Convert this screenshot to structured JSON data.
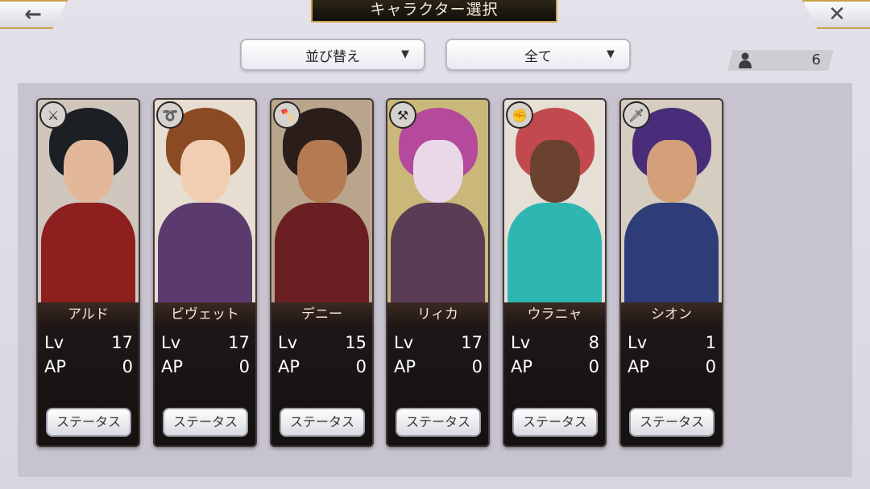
{
  "header": {
    "back_icon": "←",
    "title": "キャラクター選択",
    "close_icon": "✕"
  },
  "filters": {
    "sort_label": "並び替え",
    "filter_label": "全て",
    "arrow": "▼"
  },
  "count": {
    "value": "6"
  },
  "characters": [
    {
      "name": "アルド",
      "lv_label": "Lv",
      "lv": "17",
      "ap_label": "AP",
      "ap": "0",
      "status_label": "ステータス",
      "weapon_icon": "sword-icon",
      "weapon_glyph": "⚔",
      "colors": {
        "bg": "#cfc7bd",
        "hair": "#1c1f24",
        "face": "#e3b89a",
        "body": "#8e1f1f"
      }
    },
    {
      "name": "ビヴェット",
      "lv_label": "Lv",
      "lv": "17",
      "ap_label": "AP",
      "ap": "0",
      "status_label": "ステータス",
      "weapon_icon": "whip-icon",
      "weapon_glyph": "➰",
      "colors": {
        "bg": "#e7ddd0",
        "hair": "#8a4a23",
        "face": "#f1cdb2",
        "body": "#5b3b6e"
      }
    },
    {
      "name": "デニー",
      "lv_label": "Lv",
      "lv": "15",
      "ap_label": "AP",
      "ap": "0",
      "status_label": "ステータス",
      "weapon_icon": "axe-icon",
      "weapon_glyph": "🪓",
      "colors": {
        "bg": "#b9a58c",
        "hair": "#2a1d1a",
        "face": "#b47a52",
        "body": "#6b1f22"
      }
    },
    {
      "name": "リィカ",
      "lv_label": "Lv",
      "lv": "17",
      "ap_label": "AP",
      "ap": "0",
      "status_label": "ステータス",
      "weapon_icon": "hammer-icon",
      "weapon_glyph": "⚒",
      "colors": {
        "bg": "#c9b87a",
        "hair": "#b54a9c",
        "face": "#e9d8e8",
        "body": "#5a3d55"
      }
    },
    {
      "name": "ウラニャ",
      "lv_label": "Lv",
      "lv": "8",
      "ap_label": "AP",
      "ap": "0",
      "status_label": "ステータス",
      "weapon_icon": "fist-icon",
      "weapon_glyph": "✊",
      "colors": {
        "bg": "#e6dfd6",
        "hair": "#c24a4e",
        "face": "#6b4230",
        "body": "#2fb6b1"
      }
    },
    {
      "name": "シオン",
      "lv_label": "Lv",
      "lv": "1",
      "ap_label": "AP",
      "ap": "0",
      "status_label": "ステータス",
      "weapon_icon": "katana-icon",
      "weapon_glyph": "🗡",
      "colors": {
        "bg": "#d5cdbf",
        "hair": "#4a2d7a",
        "face": "#d4a07a",
        "body": "#2e3d78"
      }
    }
  ]
}
